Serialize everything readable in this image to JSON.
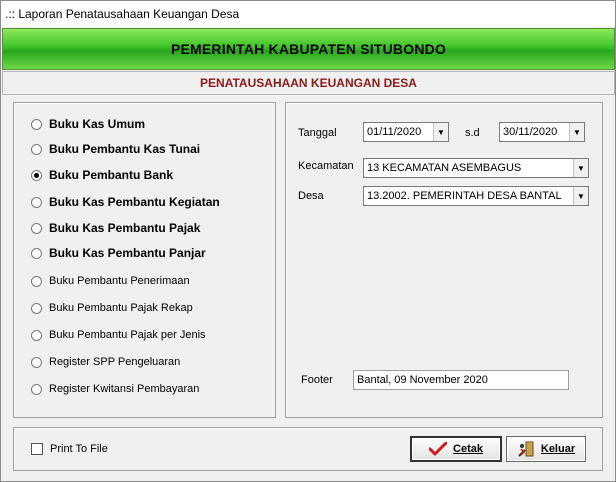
{
  "window": {
    "title": ".:: Laporan Penatausahaan Keuangan Desa"
  },
  "banner": {
    "title": "PEMERINTAH KABUPATEN SITUBONDO"
  },
  "subtitle": "PENATAUSAHAAN KEUANGAN DESA",
  "reports": [
    {
      "label": "Buku Kas Umum",
      "selected": false,
      "bold": true
    },
    {
      "label": "Buku Pembantu Kas Tunai",
      "selected": false,
      "bold": true
    },
    {
      "label": "Buku Pembantu Bank",
      "selected": true,
      "bold": true
    },
    {
      "label": "Buku Kas Pembantu Kegiatan",
      "selected": false,
      "bold": true
    },
    {
      "label": "Buku Kas Pembantu Pajak",
      "selected": false,
      "bold": true
    },
    {
      "label": "Buku Kas Pembantu Panjar",
      "selected": false,
      "bold": true
    },
    {
      "label": "Buku Pembantu Penerimaan",
      "selected": false,
      "bold": false
    },
    {
      "label": "Buku Pembantu Pajak Rekap",
      "selected": false,
      "bold": false
    },
    {
      "label": "Buku Pembantu Pajak per Jenis",
      "selected": false,
      "bold": false
    },
    {
      "label": "Register SPP Pengeluaran",
      "selected": false,
      "bold": false
    },
    {
      "label": "Register Kwitansi Pembayaran",
      "selected": false,
      "bold": false
    }
  ],
  "filters": {
    "tanggal_label": "Tanggal",
    "date_from": "01/11/2020",
    "sd_label": "s.d",
    "date_to": "30/11/2020",
    "kecamatan_label": "Kecamatan",
    "kecamatan_value": "13  KECAMATAN ASEMBAGUS",
    "desa_label": "Desa",
    "desa_value": "13.2002.  PEMERINTAH DESA BANTAL",
    "footer_label": "Footer",
    "footer_value": "Bantal,  09 November 2020"
  },
  "bottom": {
    "print_to_file_label": "Print To File",
    "print_to_file_checked": false,
    "cetak_label": "Cetak",
    "keluar_label": "Keluar"
  },
  "colors": {
    "banner_green": "#3ec228",
    "subtitle_red": "#8b1a1a"
  }
}
